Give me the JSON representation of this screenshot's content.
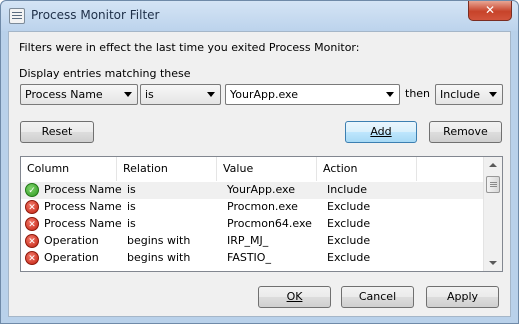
{
  "window": {
    "title": "Process Monitor Filter",
    "close_glyph": "✕"
  },
  "info_text": "Filters were in effect the last time you exited Process Monitor:",
  "match_label": "Display entries matching these",
  "filter": {
    "column": "Process Name",
    "relation": "is",
    "value": "YourApp.exe",
    "then_label": "then",
    "action": "Include"
  },
  "buttons": {
    "reset": "Reset",
    "add": "Add",
    "remove": "Remove",
    "ok": "OK",
    "cancel": "Cancel",
    "apply": "Apply"
  },
  "list": {
    "headers": [
      "Column",
      "Relation",
      "Value",
      "Action"
    ],
    "rows": [
      {
        "icon": "check-icon",
        "column": "Process Name",
        "relation": "is",
        "value": "YourApp.exe",
        "action": "Include"
      },
      {
        "icon": "x-icon",
        "column": "Process Name",
        "relation": "is",
        "value": "Procmon.exe",
        "action": "Exclude"
      },
      {
        "icon": "x-icon",
        "column": "Process Name",
        "relation": "is",
        "value": "Procmon64.exe",
        "action": "Exclude"
      },
      {
        "icon": "x-icon",
        "column": "Operation",
        "relation": "begins with",
        "value": "IRP_MJ_",
        "action": "Exclude"
      },
      {
        "icon": "x-icon",
        "column": "Operation",
        "relation": "begins with",
        "value": "FASTIO_",
        "action": "Exclude"
      }
    ]
  },
  "colors": {
    "include": "#2e9a21",
    "exclude": "#c3200f"
  }
}
